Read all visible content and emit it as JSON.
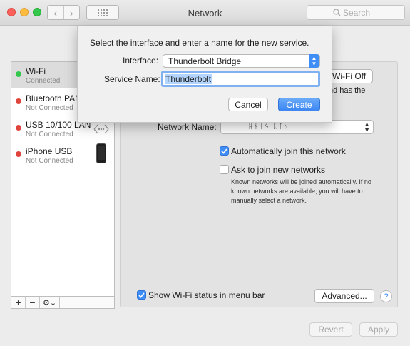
{
  "window": {
    "title": "Network"
  },
  "toolbar": {
    "back_symbol": "‹",
    "forward_symbol": "›",
    "search_placeholder": "Search"
  },
  "services": [
    {
      "name": "Wi-Fi",
      "status": "Connected",
      "status_color": "#34c84a",
      "selected": true
    },
    {
      "name": "Bluetooth PAN",
      "status": "Not Connected",
      "status_color": "#e0453d",
      "selected": false
    },
    {
      "name": "USB 10/100 LAN",
      "status": "Not Connected",
      "status_color": "#e0453d",
      "selected": false
    },
    {
      "name": "iPhone USB",
      "status": "Not Connected",
      "status_color": "#e0453d",
      "selected": false
    }
  ],
  "sidebar_tools": {
    "add": "+",
    "remove": "−",
    "gear": "⚙︎⌄"
  },
  "detail": {
    "wifi_off_button": "Wi-Fi Off",
    "status_fragment": "nd has the",
    "network_name_label": "Network Name:",
    "network_name_value": "ᚺᚾᛁᛃ ᛈᛉᛊ",
    "auto_join_label": "Automatically join this network",
    "auto_join_checked": true,
    "ask_join_label": "Ask to join new networks",
    "ask_join_checked": false,
    "help_text": "Known networks will be joined automatically. If no known networks are available, you will have to manually select a network.",
    "show_status_label": "Show Wi-Fi status in menu bar",
    "show_status_checked": true,
    "advanced_button": "Advanced...",
    "help_button": "?",
    "revert_button": "Revert",
    "apply_button": "Apply"
  },
  "sheet": {
    "prompt": "Select the interface and enter a name for the new service.",
    "interface_label": "Interface:",
    "interface_value": "Thunderbolt Bridge",
    "service_name_label": "Service Name:",
    "service_name_value": "Thunderbolt",
    "cancel_button": "Cancel",
    "create_button": "Create"
  },
  "colors": {
    "accent": "#3f8df6",
    "connected": "#34c84a",
    "not_connected": "#e0453d"
  }
}
